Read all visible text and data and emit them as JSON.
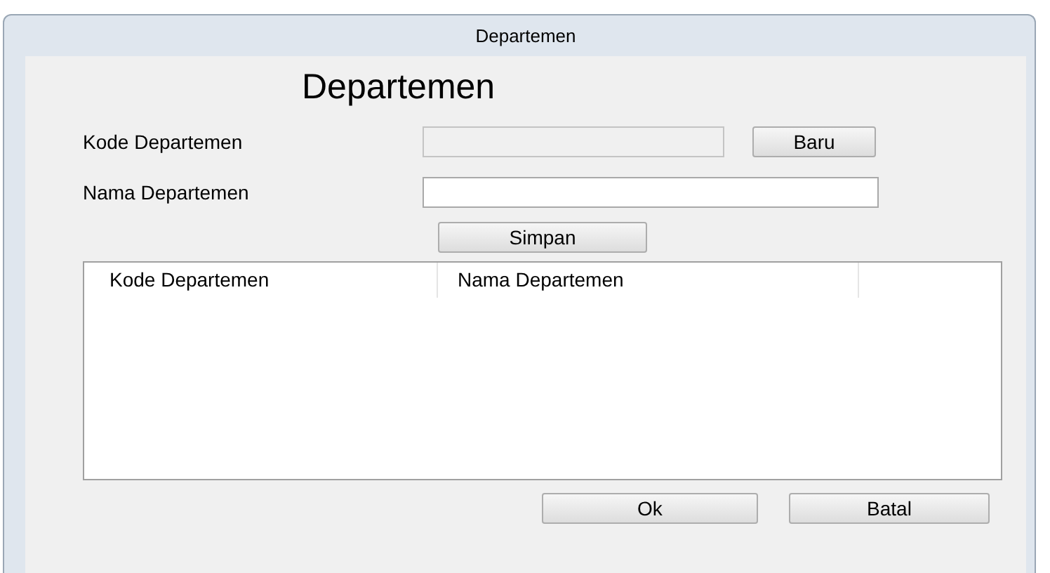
{
  "window": {
    "title": "Departemen"
  },
  "heading": "Departemen",
  "fields": [
    {
      "label": "Kode Departemen",
      "disabled": true,
      "button": "Baru"
    },
    {
      "label": "Nama Departemen",
      "disabled": false
    }
  ],
  "save_button": "Simpan",
  "table": {
    "columns": [
      "Kode Departemen",
      "Nama Departemen"
    ]
  },
  "buttons": [
    "Ok",
    "Batal"
  ]
}
